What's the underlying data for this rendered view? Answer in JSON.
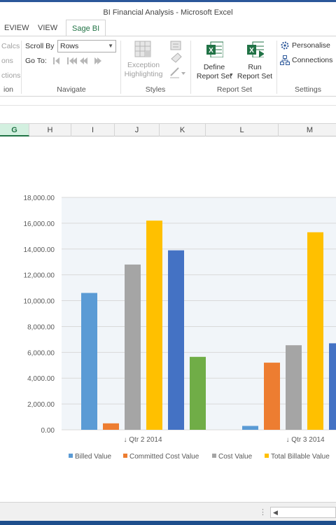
{
  "window": {
    "title": "BI Financial Analysis - Microsoft Excel"
  },
  "tabs": [
    {
      "label": "EVIEW"
    },
    {
      "label": "VIEW"
    },
    {
      "label": "Sage BI"
    }
  ],
  "ribbon": {
    "left_group": {
      "items": [
        "Calcs",
        "ons",
        "ctions"
      ],
      "label": "ion"
    },
    "navigate": {
      "scroll_by_label": "Scroll By",
      "scroll_by_value": "Rows",
      "goto_label": "Go To:",
      "label": "Navigate"
    },
    "styles": {
      "exception_line1": "Exception",
      "exception_line2": "Highlighting",
      "label": "Styles"
    },
    "report_set": {
      "define_line1": "Define",
      "define_line2": "Report Set",
      "run_line1": "Run",
      "run_line2": "Report Set",
      "label": "Report Set"
    },
    "settings": {
      "personalise": "Personalise",
      "connections": "Connections",
      "label": "Settings"
    }
  },
  "columns": [
    "G",
    "H",
    "I",
    "J",
    "K",
    "L",
    "M"
  ],
  "colors": {
    "billed": "#5b9bd5",
    "committed": "#ed7d31",
    "cost": "#a5a5a5",
    "total_billable": "#ffc000",
    "series5": "#4472c4",
    "series6": "#70ad47",
    "excel_green": "#217346"
  },
  "chart_data": {
    "type": "bar",
    "categories": [
      "Qtr 2 2014",
      "Qtr 3 2014"
    ],
    "category_prefix": "↓",
    "ylim": [
      0,
      18000
    ],
    "yticks": [
      "0.00",
      "2,000.00",
      "4,000.00",
      "6,000.00",
      "8,000.00",
      "10,000.00",
      "12,000.00",
      "14,000.00",
      "16,000.00",
      "18,000.00"
    ],
    "series": [
      {
        "name": "Billed Value",
        "color": "#5b9bd5",
        "values": [
          10600,
          300
        ]
      },
      {
        "name": "Committed Cost Value",
        "color": "#ed7d31",
        "values": [
          500,
          5200
        ]
      },
      {
        "name": "Cost Value",
        "color": "#a5a5a5",
        "values": [
          12800,
          6550
        ]
      },
      {
        "name": "Total Billable Value",
        "color": "#ffc000",
        "values": [
          16200,
          15300
        ]
      },
      {
        "color": "#4472c4",
        "values": [
          13900,
          6700
        ]
      },
      {
        "color": "#70ad47",
        "values": [
          5650,
          null
        ]
      }
    ],
    "legend_position": "bottom",
    "grid": true
  }
}
